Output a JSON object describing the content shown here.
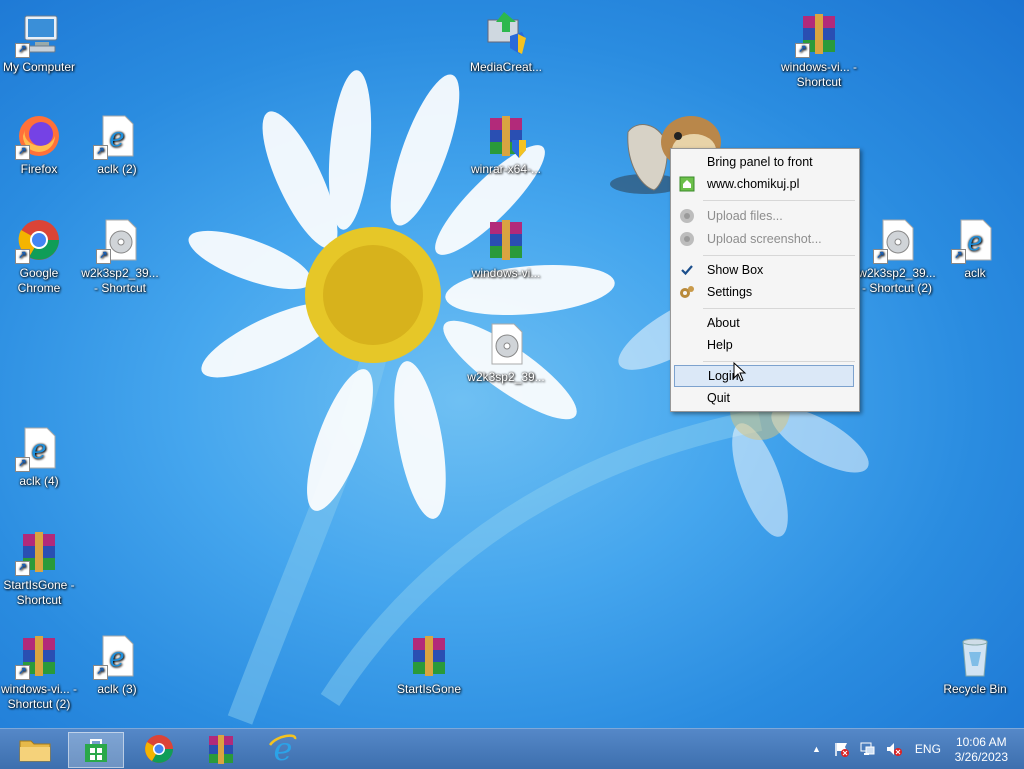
{
  "desktop_icons": [
    {
      "label": "My Computer"
    },
    {
      "label": "Firefox"
    },
    {
      "label": "aclk (2)"
    },
    {
      "label": "Google Chrome"
    },
    {
      "label": "w2k3sp2_39... - Shortcut"
    },
    {
      "label": "aclk (4)"
    },
    {
      "label": "StartIsGone - Shortcut"
    },
    {
      "label": "windows-vi... - Shortcut (2)"
    },
    {
      "label": "aclk (3)"
    },
    {
      "label": "MediaCreat..."
    },
    {
      "label": "winrar-x64-..."
    },
    {
      "label": "windows-vi..."
    },
    {
      "label": "w2k3sp2_39..."
    },
    {
      "label": "StartIsGone"
    },
    {
      "label": "windows-vi... - Shortcut"
    },
    {
      "label": "w2k3sp2_39... - Shortcut (2)"
    },
    {
      "label": "aclk"
    },
    {
      "label": "Recycle Bin"
    }
  ],
  "context_menu": {
    "items": [
      {
        "label": "Bring panel to front"
      },
      {
        "label": "www.chomikuj.pl"
      },
      {
        "label": "Upload files..."
      },
      {
        "label": "Upload screenshot..."
      },
      {
        "label": "Show Box"
      },
      {
        "label": "Settings"
      },
      {
        "label": "About"
      },
      {
        "label": "Help"
      },
      {
        "label": "Login"
      },
      {
        "label": "Quit"
      }
    ]
  },
  "taskbar": {
    "language": "ENG",
    "time": "10:06 AM",
    "date": "3/26/2023",
    "tray_chevron": "▲"
  },
  "colors": {
    "accent": "#1b74d2",
    "taskbar": "#3f73b4"
  }
}
